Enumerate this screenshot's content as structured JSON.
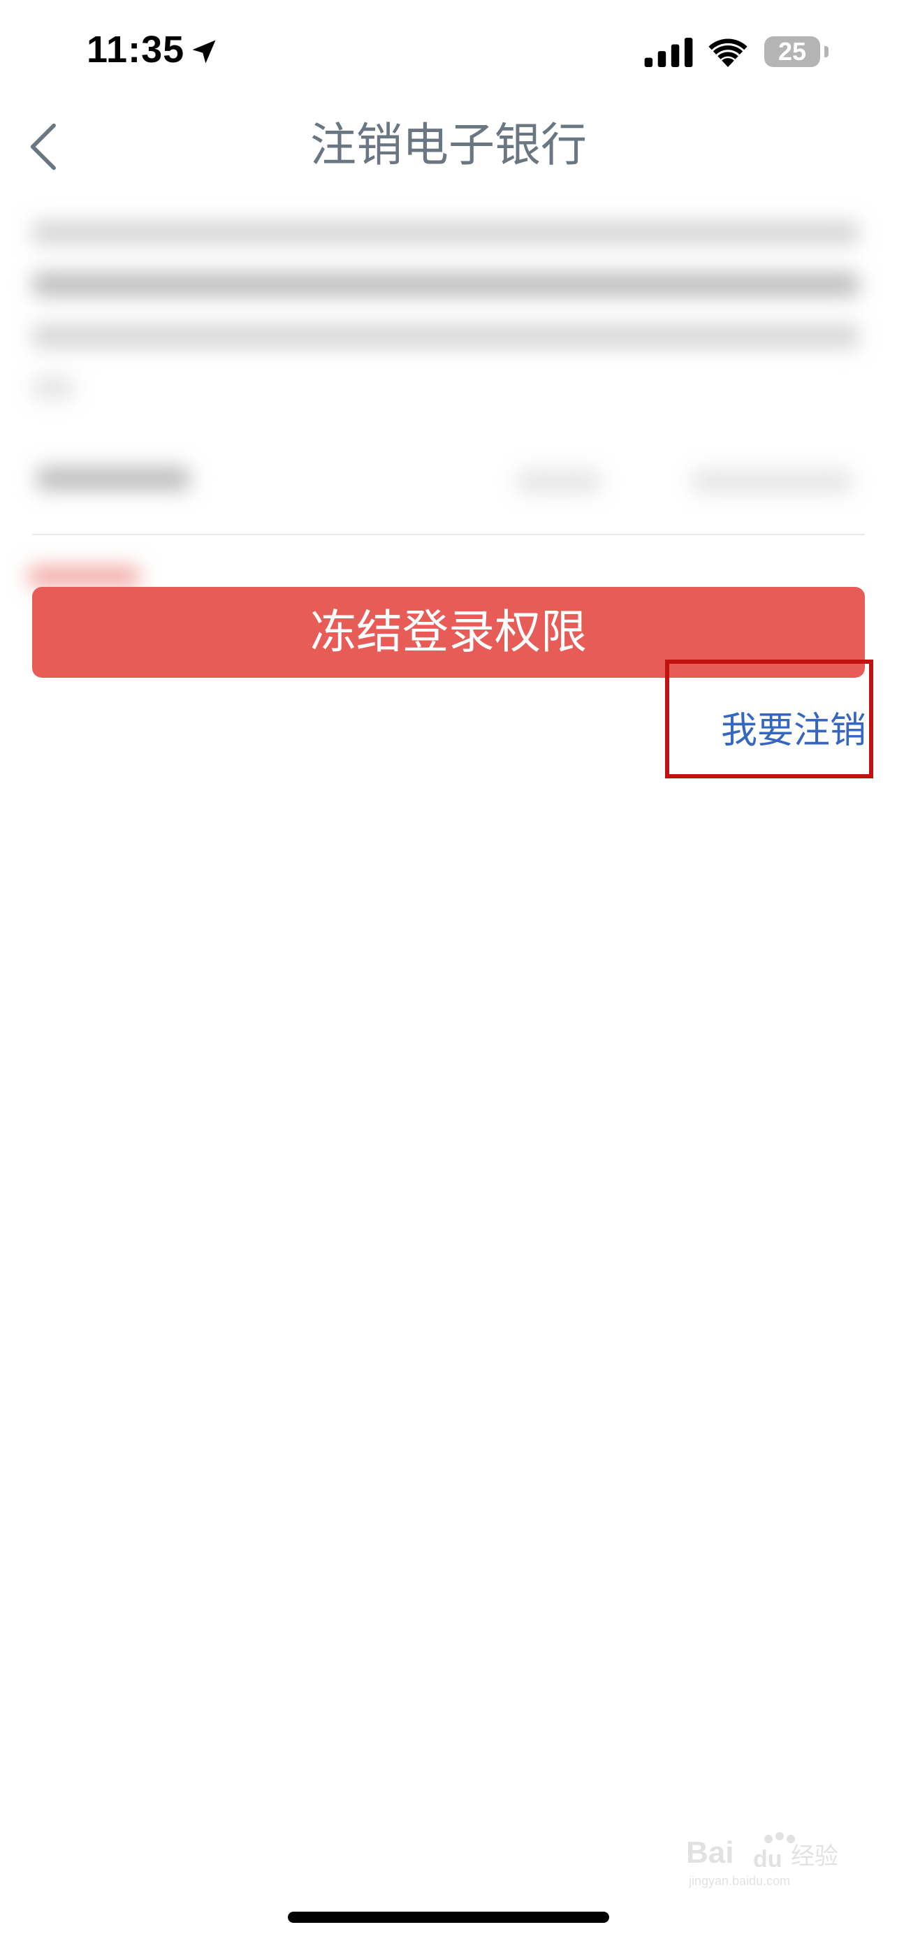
{
  "status_bar": {
    "time": "11:35",
    "battery": "25",
    "icons": [
      "location-arrow-icon",
      "signal-icon",
      "wifi-icon",
      "battery-icon"
    ]
  },
  "nav": {
    "back_icon": "chevron-left-icon",
    "title": "注销电子银行"
  },
  "actions": {
    "freeze_label": "冻结登录权限",
    "cancel_label": "我要注销"
  },
  "colors": {
    "primary_red": "#e85c58",
    "link_blue": "#3566c0",
    "highlight_red": "#c0130f",
    "title_gray": "#6b7683"
  },
  "watermark": {
    "brand": "Baidu经验",
    "url": "jingyan.baidu.com"
  }
}
